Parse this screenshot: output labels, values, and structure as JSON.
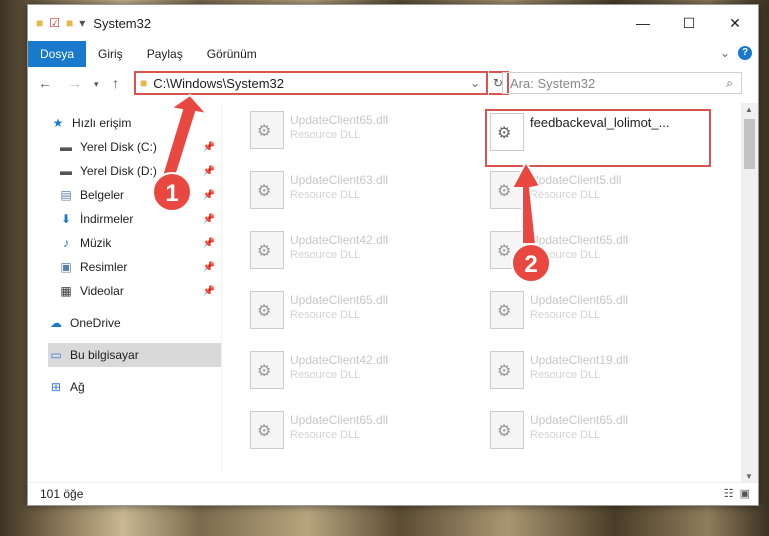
{
  "window": {
    "title": "System32",
    "caption": {
      "minimize": "—",
      "maximize": "☐",
      "close": "✕"
    }
  },
  "ribbon": {
    "tabs": [
      "Dosya",
      "Giriş",
      "Paylaş",
      "Görünüm"
    ],
    "help": "?"
  },
  "address": {
    "path": "C:\\Windows\\System32"
  },
  "search": {
    "placeholder": "Ara: System32"
  },
  "sidebar": {
    "items": [
      {
        "label": "Hızlı erişim",
        "icon": "star-icon"
      },
      {
        "label": "Yerel Disk (C:)",
        "icon": "drive-icon",
        "pinned": true
      },
      {
        "label": "Yerel Disk (D:)",
        "icon": "drive-icon",
        "pinned": true
      },
      {
        "label": "Belgeler",
        "icon": "documents-icon",
        "pinned": true
      },
      {
        "label": "İndirmeler",
        "icon": "download-icon",
        "pinned": true
      },
      {
        "label": "Müzik",
        "icon": "music-icon",
        "pinned": true
      },
      {
        "label": "Resimler",
        "icon": "pictures-icon",
        "pinned": true
      },
      {
        "label": "Videolar",
        "icon": "videos-icon",
        "pinned": true
      },
      {
        "label": "OneDrive",
        "icon": "cloud-icon"
      },
      {
        "label": "Bu bilgisayar",
        "icon": "computer-icon",
        "selected": true
      },
      {
        "label": "Ağ",
        "icon": "network-icon"
      }
    ]
  },
  "files": {
    "left": [
      {
        "name": "UpdateClient65.dll",
        "type": "Resource DLL"
      },
      {
        "name": "UpdateClient63.dll",
        "type": "Resource DLL"
      },
      {
        "name": "UpdateClient42.dll",
        "type": "Resource DLL"
      },
      {
        "name": "UpdateClient65.dll",
        "type": "Resource DLL"
      },
      {
        "name": "UpdateClient42.dll",
        "type": "Resource DLL"
      },
      {
        "name": "UpdateClient65.dll",
        "type": "Resource DLL"
      }
    ],
    "right": [
      {
        "name": "feedbackeval_lolimot_...",
        "type": "",
        "highlight": true
      },
      {
        "name": "UpdateClient5.dll",
        "type": "Resource DLL"
      },
      {
        "name": "UpdateClient65.dll",
        "type": "Resource DLL"
      },
      {
        "name": "UpdateClient65.dll",
        "type": "Resource DLL"
      },
      {
        "name": "UpdateClient19.dll",
        "type": "Resource DLL"
      },
      {
        "name": "UpdateClient65.dll",
        "type": "Resource DLL"
      }
    ]
  },
  "status": {
    "count": "101 öğe"
  },
  "annotations": {
    "step1": "1",
    "step2": "2"
  },
  "colors": {
    "accent": "#1979ca",
    "highlight": "#d9534f",
    "marker": "#e8483f"
  }
}
